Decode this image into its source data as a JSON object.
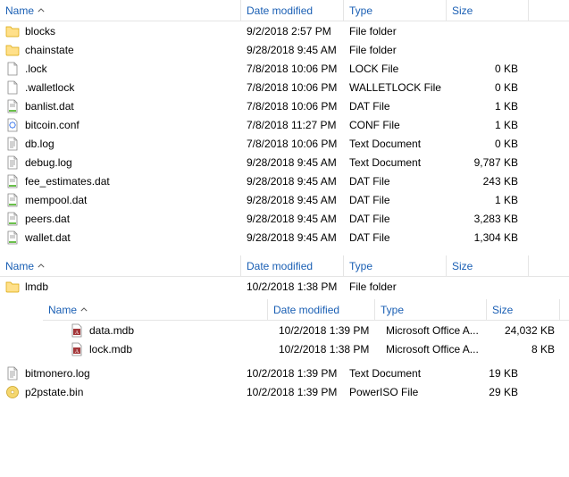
{
  "columns": {
    "name": "Name",
    "date": "Date modified",
    "type": "Type",
    "size": "Size"
  },
  "section1": {
    "rows": [
      {
        "icon": "folder",
        "name": "blocks",
        "date": "9/2/2018 2:57 PM",
        "type": "File folder",
        "size": ""
      },
      {
        "icon": "folder",
        "name": "chainstate",
        "date": "9/28/2018 9:45 AM",
        "type": "File folder",
        "size": ""
      },
      {
        "icon": "file",
        "name": ".lock",
        "date": "7/8/2018 10:06 PM",
        "type": "LOCK File",
        "size": "0 KB"
      },
      {
        "icon": "file",
        "name": ".walletlock",
        "date": "7/8/2018 10:06 PM",
        "type": "WALLETLOCK File",
        "size": "0 KB"
      },
      {
        "icon": "datfile",
        "name": "banlist.dat",
        "date": "7/8/2018 10:06 PM",
        "type": "DAT File",
        "size": "1 KB"
      },
      {
        "icon": "conf",
        "name": "bitcoin.conf",
        "date": "7/8/2018 11:27 PM",
        "type": "CONF File",
        "size": "1 KB"
      },
      {
        "icon": "text",
        "name": "db.log",
        "date": "7/8/2018 10:06 PM",
        "type": "Text Document",
        "size": "0 KB"
      },
      {
        "icon": "text",
        "name": "debug.log",
        "date": "9/28/2018 9:45 AM",
        "type": "Text Document",
        "size": "9,787 KB"
      },
      {
        "icon": "datfile",
        "name": "fee_estimates.dat",
        "date": "9/28/2018 9:45 AM",
        "type": "DAT File",
        "size": "243 KB"
      },
      {
        "icon": "datfile",
        "name": "mempool.dat",
        "date": "9/28/2018 9:45 AM",
        "type": "DAT File",
        "size": "1 KB"
      },
      {
        "icon": "datfile",
        "name": "peers.dat",
        "date": "9/28/2018 9:45 AM",
        "type": "DAT File",
        "size": "3,283 KB"
      },
      {
        "icon": "datfile",
        "name": "wallet.dat",
        "date": "9/28/2018 9:45 AM",
        "type": "DAT File",
        "size": "1,304 KB"
      }
    ]
  },
  "section2": {
    "rows_before_nested": [
      {
        "icon": "folder",
        "name": "lmdb",
        "date": "10/2/2018 1:38 PM",
        "type": "File folder",
        "size": ""
      }
    ],
    "nested_rows": [
      {
        "icon": "access",
        "name": "data.mdb",
        "date": "10/2/2018 1:39 PM",
        "type": "Microsoft Office A...",
        "size": "24,032 KB"
      },
      {
        "icon": "access",
        "name": "lock.mdb",
        "date": "10/2/2018 1:38 PM",
        "type": "Microsoft Office A...",
        "size": "8 KB"
      }
    ],
    "rows_after_nested": [
      {
        "icon": "text",
        "name": "bitmonero.log",
        "date": "10/2/2018 1:39 PM",
        "type": "Text Document",
        "size": "19 KB"
      },
      {
        "icon": "iso",
        "name": "p2pstate.bin",
        "date": "10/2/2018 1:39 PM",
        "type": "PowerISO File",
        "size": "29 KB"
      }
    ]
  }
}
